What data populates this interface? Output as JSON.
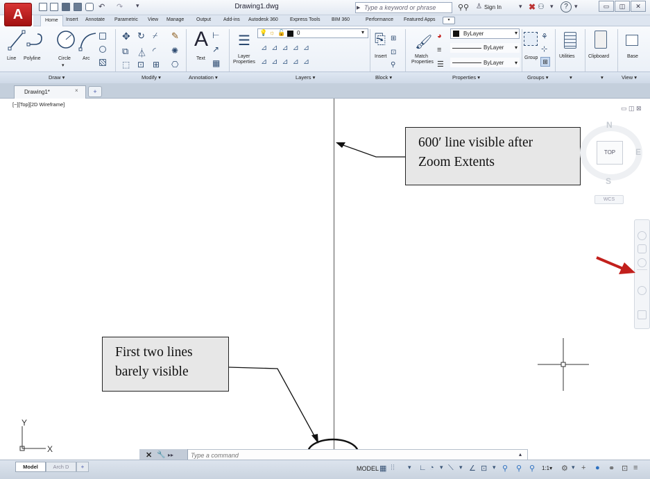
{
  "app": {
    "logo_letter": "A",
    "document_title": "Drawing1.dwg",
    "search_placeholder": "Type a keyword or phrase",
    "sign_in": "Sign In",
    "help": "?"
  },
  "ribbon_tabs": [
    "Home",
    "Insert",
    "Annotate",
    "Parametric",
    "View",
    "Manage",
    "Output",
    "Add-ins",
    "Autodesk 360",
    "Express Tools",
    "BIM 360",
    "Performance",
    "Featured Apps"
  ],
  "draw_tools": {
    "line": "Line",
    "polyline": "Polyline",
    "circle": "Circle",
    "arc": "Arc"
  },
  "annotation_tools": {
    "text": "Text"
  },
  "layer_tools": {
    "layer_properties_1": "Layer",
    "layer_properties_2": "Properties",
    "current_layer": "0"
  },
  "block_tools": {
    "insert": "Insert"
  },
  "property_tools": {
    "match_1": "Match",
    "match_2": "Properties",
    "color": "ByLayer",
    "linetype": "ByLayer",
    "lineweight": "ByLayer"
  },
  "group_tools": {
    "group": "Group"
  },
  "other_tools": {
    "utilities": "Utilities",
    "clipboard": "Clipboard",
    "base": "Base"
  },
  "panels": [
    "Draw",
    "Modify",
    "Annotation",
    "Layers",
    "Block",
    "Properties",
    "Groups",
    "View"
  ],
  "document_tab": {
    "name": "Drawing1*",
    "close": "×",
    "add": "+"
  },
  "viewport_label": "[−][Top][2D Wireframe]",
  "viewport_controls": "▭ ◫ ⊠",
  "callouts": {
    "top_line_1": "600′ line visible after",
    "top_line_2": "Zoom Extents",
    "bottom_line_1": "First two lines",
    "bottom_line_2": "barely visible"
  },
  "viewcube": {
    "north": "N",
    "south": "S",
    "east": "E",
    "face": "TOP",
    "wcs": "WCS"
  },
  "ucs": {
    "x": "X",
    "y": "Y"
  },
  "command_line": {
    "placeholder": "Type a command",
    "close": "✕",
    "wrench": "🔧",
    "prompt": "▸▸"
  },
  "layout_tabs": {
    "model": "Model",
    "layout": "Arch D",
    "add": "+"
  },
  "status_bar": {
    "model": "MODEL",
    "scale": "1:1"
  },
  "colors": {
    "app_red": "#c8202a",
    "accent_blue": "#2b6fc0",
    "annotation_red": "#c2201c"
  }
}
